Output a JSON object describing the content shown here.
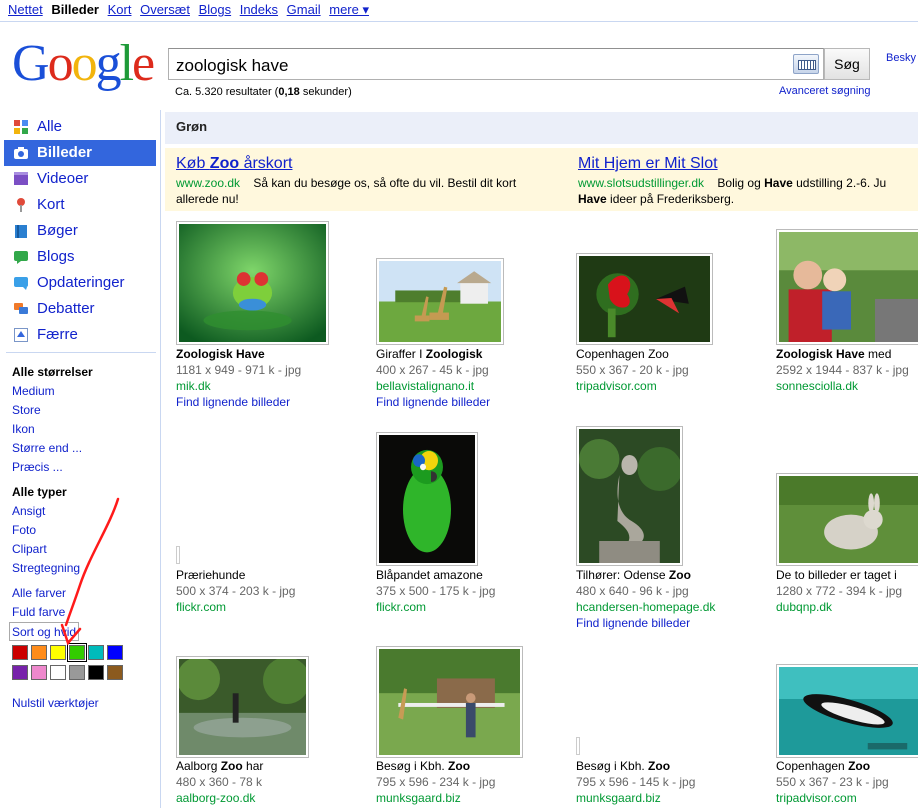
{
  "topbar": {
    "links": [
      "Nettet",
      "Billeder",
      "Kort",
      "Oversæt",
      "Blogs",
      "Indeks",
      "Gmail",
      "mere ▾"
    ],
    "current": "Billeder"
  },
  "logo": [
    "G",
    "o",
    "o",
    "g",
    "l",
    "e"
  ],
  "search": {
    "query": "zoologisk have",
    "button": "Søg",
    "stats_prefix": "Ca. 5.320 resultater (",
    "stats_time": "0,18",
    "stats_suffix": " sekunder)",
    "advanced": "Avanceret søgning",
    "besky": "Besky"
  },
  "nav": {
    "items": [
      {
        "label": "Alle",
        "icon": "everything-icon",
        "color": "#4a8cf0"
      },
      {
        "label": "Billeder",
        "icon": "camera-icon",
        "color": "#3366dd",
        "selected": true
      },
      {
        "label": "Videoer",
        "icon": "video-icon",
        "color": "#7b4fc4"
      },
      {
        "label": "Kort",
        "icon": "map-pin-icon",
        "color": "#e04a3a"
      },
      {
        "label": "Bøger",
        "icon": "book-icon",
        "color": "#2a7fd0"
      },
      {
        "label": "Blogs",
        "icon": "blog-icon",
        "color": "#32a84a"
      },
      {
        "label": "Opdateringer",
        "icon": "updates-icon",
        "color": "#3aa0e8"
      },
      {
        "label": "Debatter",
        "icon": "discussion-icon",
        "color": "#f07a2a"
      },
      {
        "label": "Færre",
        "icon": "fewer-icon",
        "color": "#3366dd"
      }
    ]
  },
  "tools": {
    "sizes_header": "Alle størrelser",
    "sizes": [
      "Medium",
      "Store",
      "Ikon",
      "Større end ...",
      "Præcis ..."
    ],
    "types_header": "Alle typer",
    "types": [
      "Ansigt",
      "Foto",
      "Clipart",
      "Stregtegning"
    ],
    "colors": [
      "Alle farver",
      "Fuld farve",
      "Sort og hvid"
    ],
    "swatches": [
      "#cc0000",
      "#ff8c1a",
      "#ffff00",
      "#33cc00",
      "#00bbbb",
      "#0000ff",
      "#7722aa",
      "#ee88cc",
      "#ffffff",
      "#999999",
      "#000000",
      "#8b5a1e"
    ],
    "active_swatch": 3,
    "reset": "Nulstil værktøjer"
  },
  "subhead": "Grøn",
  "ads": [
    {
      "title_pre": "Køb ",
      "title_bold": "Zoo",
      "title_post": " årskort",
      "url": "www.zoo.dk",
      "desc1": "Så kan du besøge os, så ofte du vil. Bestil dit kort",
      "desc2": "allerede nu!"
    },
    {
      "title_pre": "Mit Hjem er Mit Slot",
      "title_bold": "",
      "title_post": "",
      "url": "www.slotsudstillinger.dk",
      "desc1_pre": "Bolig og ",
      "desc1_bold": "Have",
      "desc1_post": " udstilling 2.-6. Ju",
      "desc2_bold": "Have",
      "desc2_post": " ideer på Frederiksberg."
    }
  ],
  "results": [
    {
      "title_bold": "Zoologisk Have",
      "title_rest": "",
      "meta": "1181 x 949 - 971 k - jpg",
      "src": "mik.dk",
      "similar": "Find lignende billeder",
      "art": "frog"
    },
    {
      "title_plain": "Giraffer I ",
      "title_bold": "Zoologisk",
      "meta": "400 x 267 - 45 k - jpg",
      "src": "bellavistalignano.it",
      "similar": "Find lignende billeder",
      "art": "giraffes"
    },
    {
      "title_plain": "Copenhagen Zoo",
      "title_bold": "",
      "meta": "550 x 367 - 20 k - jpg",
      "src": "tripadvisor.com",
      "art": "butterfly"
    },
    {
      "title_bold": "Zoologisk Have",
      "title_rest": " med",
      "meta": "2592 x 1944 - 837 k - jpg",
      "src": "sonnesciolla.dk",
      "art": "family"
    },
    {
      "title_plain": "Præriehunde",
      "title_bold": "",
      "meta": "500 x 374 - 203 k - jpg",
      "src": "flickr.com",
      "art": "none"
    },
    {
      "title_plain": "Blåpandet amazone",
      "title_bold": "",
      "meta": "375 x 500 - 175 k - jpg",
      "src": "flickr.com",
      "art": "parrot"
    },
    {
      "title_plain": "Tilhører: Odense ",
      "title_bold": "Zoo",
      "meta": "480 x 640 - 96 k - jpg",
      "src": "hcandersen-homepage.dk",
      "similar": "Find lignende billeder",
      "art": "mermaid"
    },
    {
      "title_plain": "De to billeder er taget i",
      "title_bold": "",
      "meta": "1280 x 772 - 394 k - jpg",
      "src": "dubqnp.dk",
      "art": "rabbit"
    },
    {
      "title_plain": "Aalborg ",
      "title_bold": "Zoo",
      "title_rest": " har",
      "meta": "480 x 360 - 78 k",
      "src": "aalborg-zoo.dk",
      "art": "pond"
    },
    {
      "title_plain": "Besøg i Kbh. ",
      "title_bold": "Zoo",
      "meta": "795 x 596 - 234 k - jpg",
      "src": "munksgaard.biz",
      "art": "zoopark"
    },
    {
      "title_plain": "Besøg i Kbh. ",
      "title_bold": "Zoo",
      "meta": "795 x 596 - 145 k - jpg",
      "src": "munksgaard.biz",
      "art": "none"
    },
    {
      "title_plain": "Copenhagen ",
      "title_bold": "Zoo",
      "meta": "550 x 367 - 23 k - jpg",
      "src": "tripadvisor.com",
      "art": "penguin"
    }
  ]
}
